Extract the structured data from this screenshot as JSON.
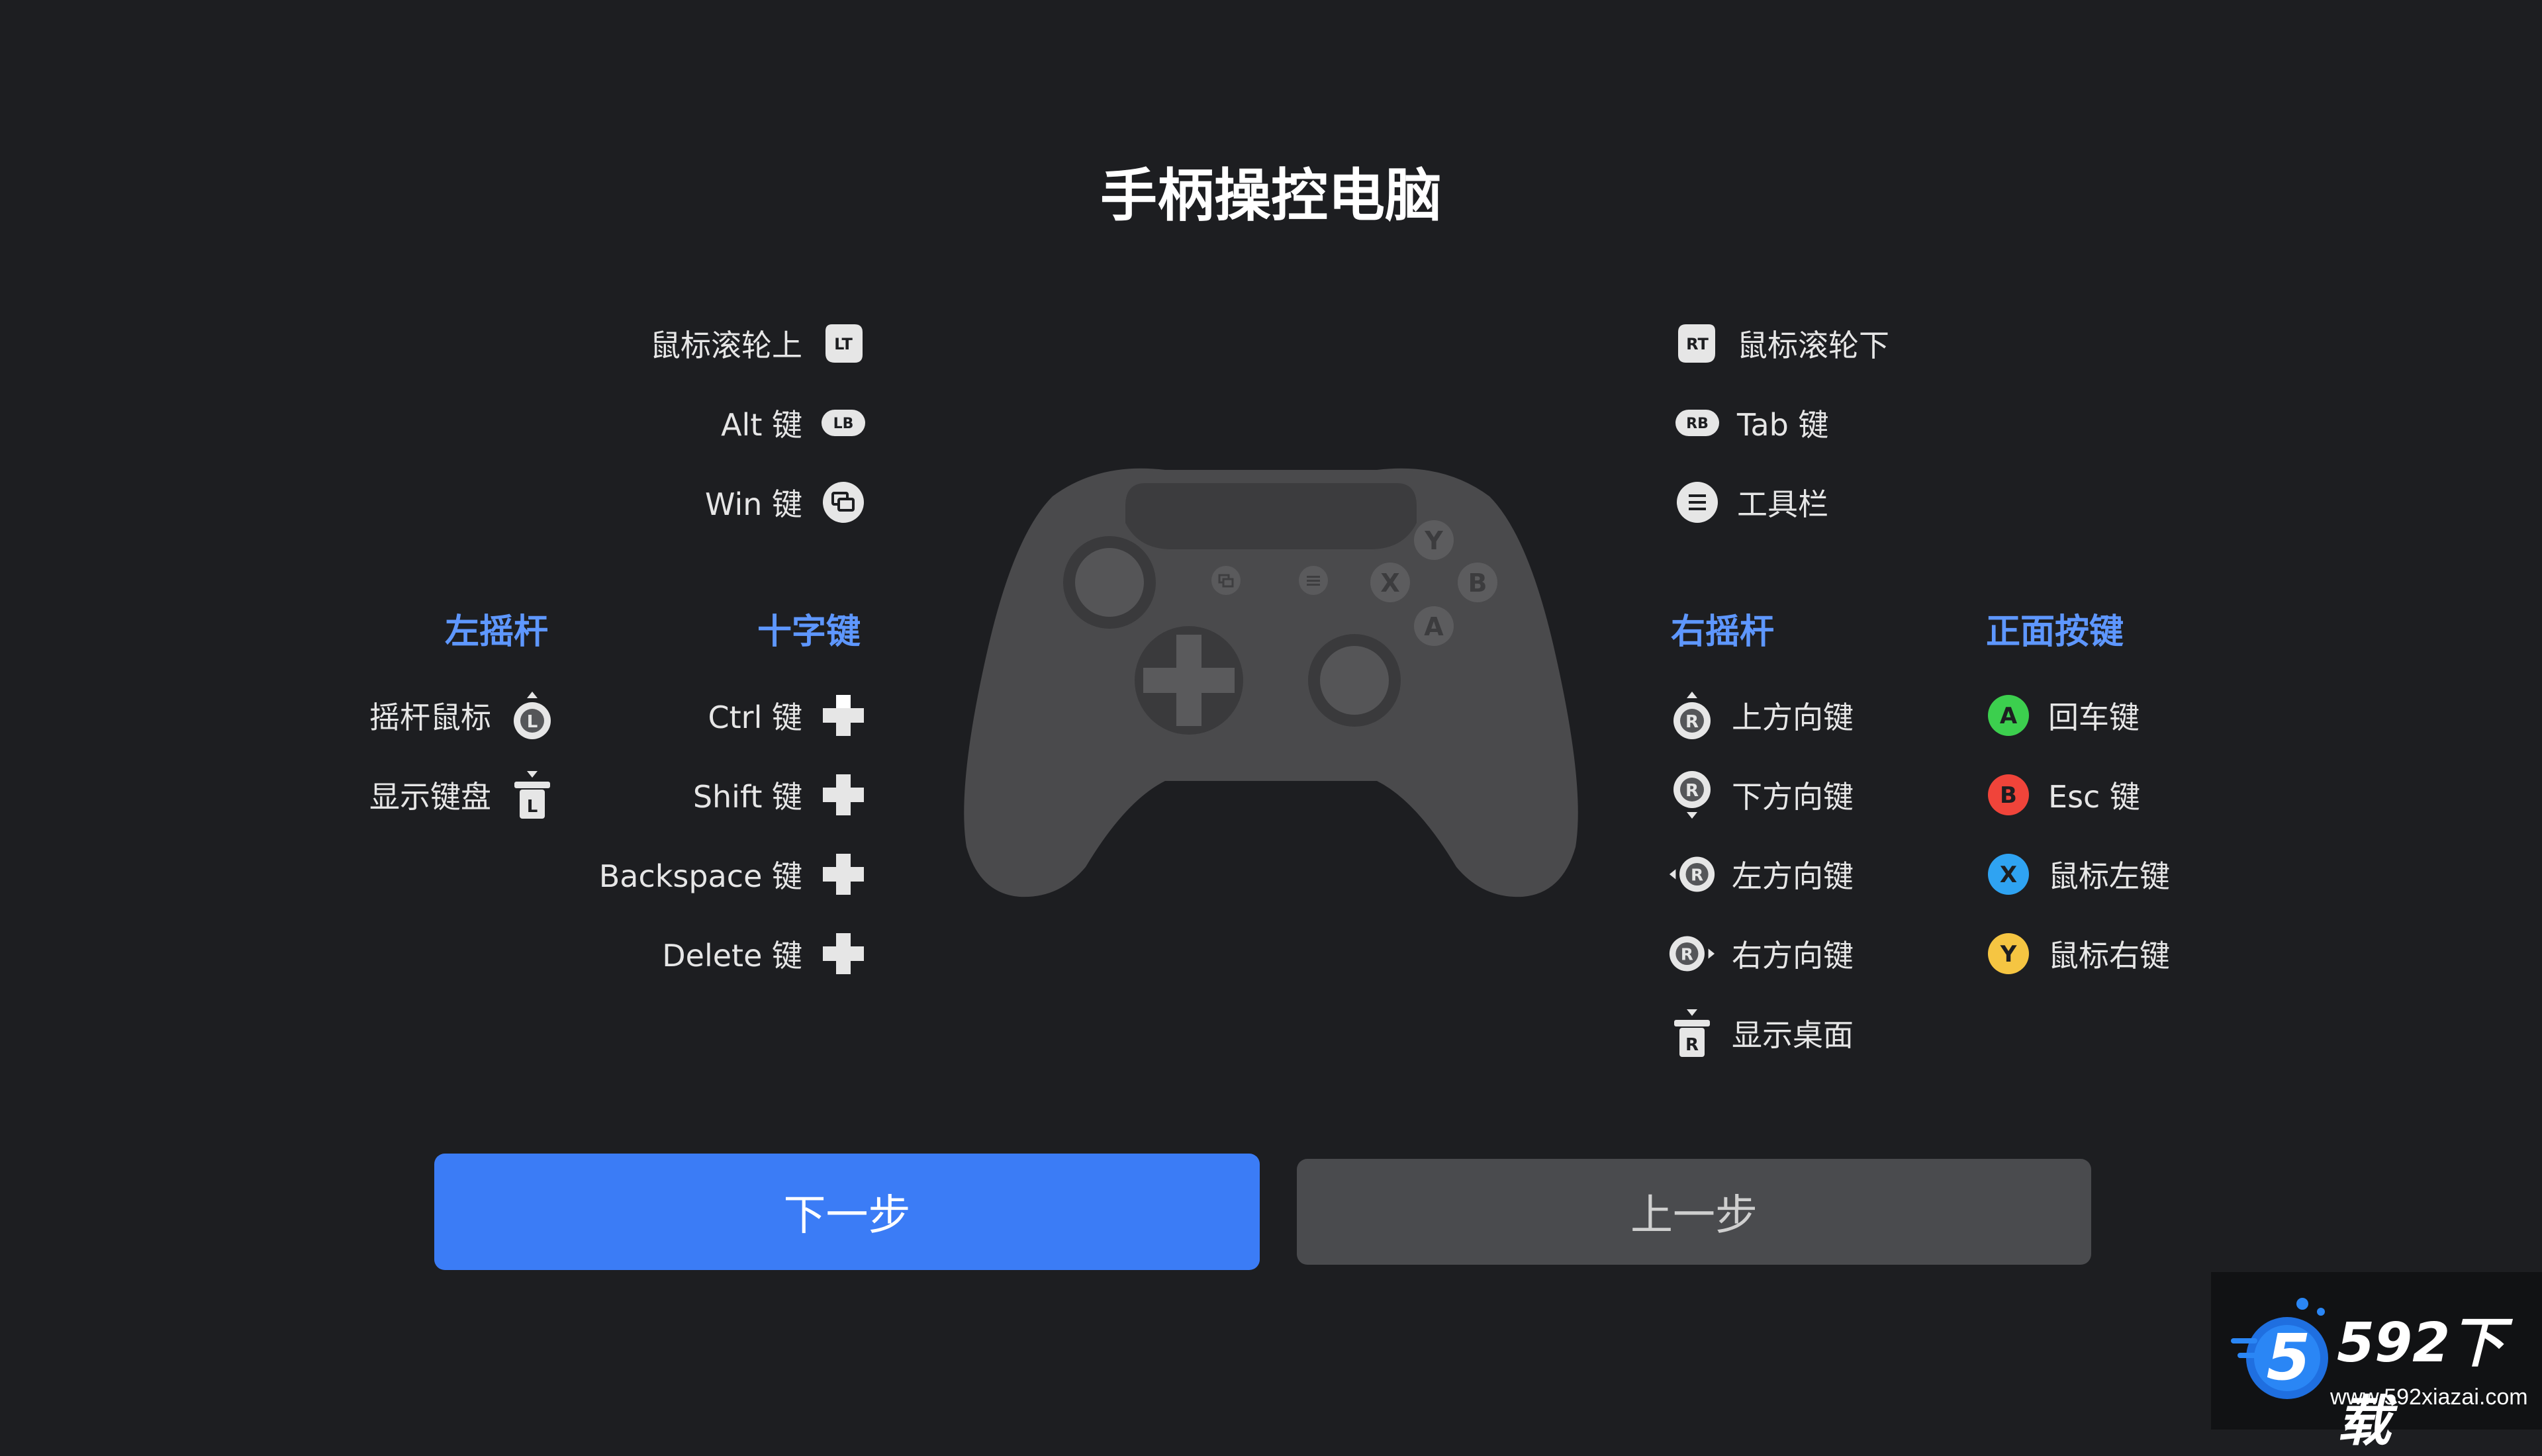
{
  "title": "手柄操控电脑",
  "left_shoulder": [
    {
      "label": "鼠标滚轮上",
      "badge": "LT",
      "icon": "lt-trigger-icon"
    },
    {
      "label": "Alt 键",
      "badge": "LB",
      "icon": "lb-bumper-icon"
    },
    {
      "label": "Win 键",
      "icon": "view-button-icon"
    }
  ],
  "right_shoulder": [
    {
      "label": "鼠标滚轮下",
      "badge": "RT",
      "icon": "rt-trigger-icon"
    },
    {
      "label": "Tab 键",
      "badge": "RB",
      "icon": "rb-bumper-icon"
    },
    {
      "label": "工具栏",
      "icon": "menu-button-icon"
    }
  ],
  "sections": {
    "left_stick": "左摇杆",
    "dpad": "十字键",
    "right_stick": "右摇杆",
    "face_buttons": "正面按键"
  },
  "left_stick_items": [
    {
      "label": "摇杆鼠标",
      "letter": "L"
    },
    {
      "label": "显示键盘",
      "letter": "L"
    }
  ],
  "dpad_items": [
    {
      "label": "Ctrl 键",
      "dir": "up"
    },
    {
      "label": "Shift 键",
      "dir": "down"
    },
    {
      "label": "Backspace 键",
      "dir": "left"
    },
    {
      "label": "Delete 键",
      "dir": "right"
    }
  ],
  "right_stick_items": [
    {
      "label": "上方向键",
      "letter": "R"
    },
    {
      "label": "下方向键",
      "letter": "R"
    },
    {
      "label": "左方向键",
      "letter": "R"
    },
    {
      "label": "右方向键",
      "letter": "R"
    },
    {
      "label": "显示桌面",
      "letter": "R"
    }
  ],
  "face_items": [
    {
      "label": "回车键",
      "letter": "A",
      "color": "#3ccf4e"
    },
    {
      "label": "Esc 键",
      "letter": "B",
      "color": "#f0443a"
    },
    {
      "label": "鼠标左键",
      "letter": "X",
      "color": "#2fa3f2"
    },
    {
      "label": "鼠标右键",
      "letter": "Y",
      "color": "#f5c542"
    }
  ],
  "controller_labels": {
    "y": "Y",
    "x": "X",
    "b": "B",
    "a": "A"
  },
  "buttons": {
    "next": "下一步",
    "prev": "上一步"
  },
  "watermark": {
    "brand": "592下载",
    "logo": "5",
    "url": "www.592xiazai.com"
  },
  "colors": {
    "accent": "#3b7cf6",
    "section": "#5e97ff",
    "background": "#1d1e21"
  }
}
